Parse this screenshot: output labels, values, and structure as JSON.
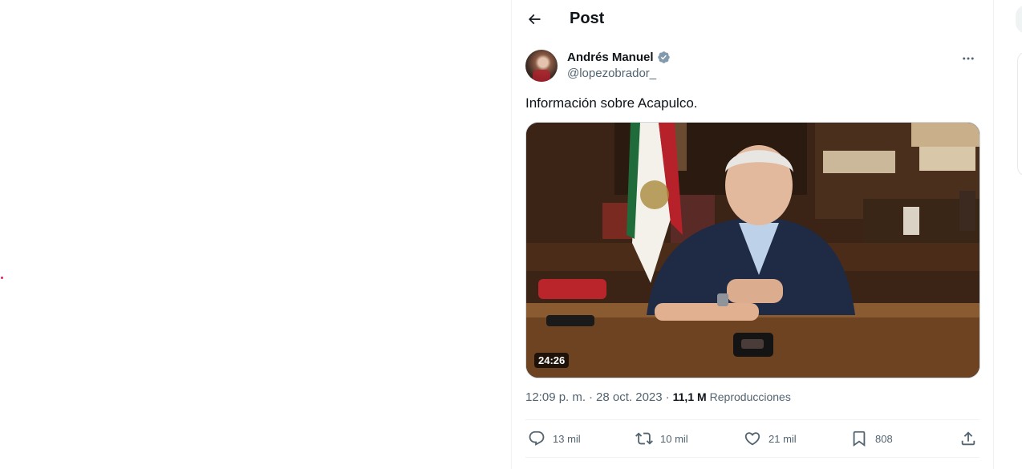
{
  "header": {
    "title": "Post"
  },
  "author": {
    "name": "Andrés Manuel",
    "handle": "@lopezobrador_"
  },
  "tweet": {
    "text": "Información sobre Acapulco."
  },
  "media": {
    "duration": "24:26"
  },
  "meta": {
    "time": "12:09 p. m.",
    "separator": "·",
    "date": "28 oct. 2023",
    "views_count": "11,1 M",
    "views_label": "Reproducciones"
  },
  "actions": {
    "replies": "13 mil",
    "reposts": "10 mil",
    "likes": "21 mil",
    "bookmarks": "808"
  },
  "colors": {
    "text": "#0f1419",
    "secondary": "#536471",
    "verified": "#829aab",
    "border": "#eff3f4"
  }
}
